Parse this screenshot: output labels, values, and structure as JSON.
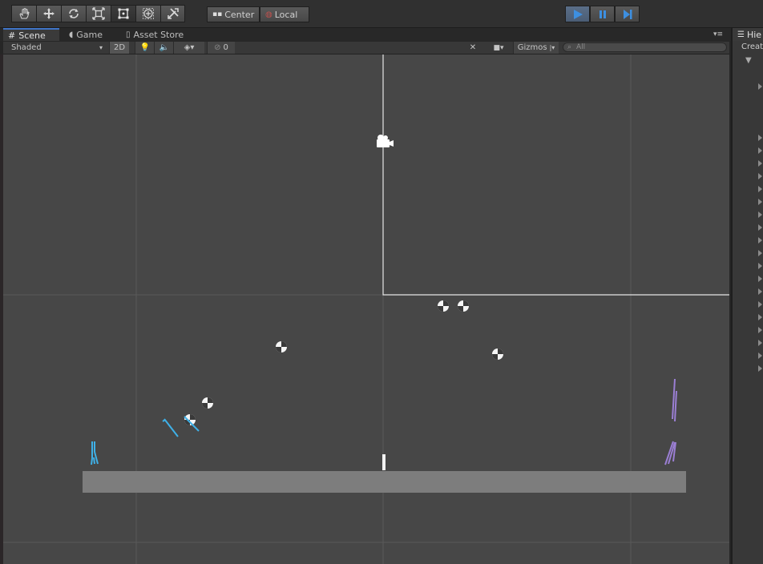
{
  "toolbar": {
    "tools": [
      "hand-tool",
      "move-tool",
      "rotate-tool",
      "scale-tool",
      "rect-tool",
      "transform-tool",
      "custom-tool"
    ],
    "active_tool": "rect-tool",
    "pivot_mode_label": "Center",
    "pivot_rotation_label": "Local",
    "play_controls": [
      "play",
      "pause",
      "step"
    ],
    "playing": true,
    "accent_color": "#3d8fe0"
  },
  "tabs": {
    "scene": "Scene",
    "game": "Game",
    "asset_store": "Asset Store",
    "hierarchy": "Hie",
    "hierarchy_create": "Creat"
  },
  "scene_toolbar": {
    "draw_mode": "Shaded",
    "mode_2d": "2D",
    "hidden_count": "0",
    "gizmos_label": "Gizmos",
    "search_placeholder": "All"
  },
  "scene": {
    "background_color": "#474747",
    "grid_color": "#5a5a5a",
    "ground_color": "#7d7d7d",
    "player_left_color": "#3fb1e8",
    "player_right_color": "#9b7fd4",
    "camera_icon": "camera-gizmo-icon",
    "ball_count": 7
  }
}
